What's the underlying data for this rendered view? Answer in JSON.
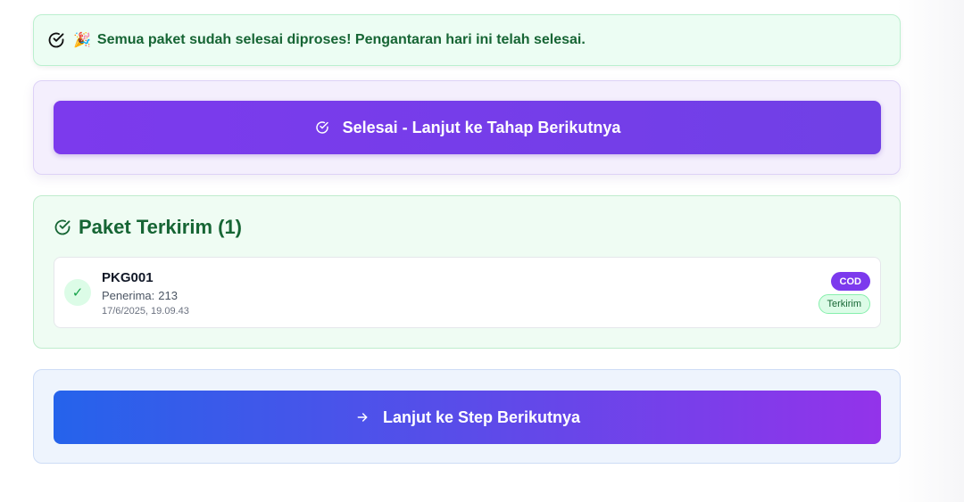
{
  "alert": {
    "icon": "check-circle-icon",
    "emoji": "🎉",
    "message": "Semua paket sudah selesai diproses! Pengantaran hari ini telah selesai."
  },
  "finish_button": {
    "icon": "check-circle-icon",
    "label": "Selesai - Lanjut ke Tahap Berikutnya"
  },
  "delivered": {
    "title": "Paket Terkirim (1)",
    "packages": [
      {
        "id": "PKG001",
        "recipient_label": "Penerima:",
        "recipient": "213",
        "timestamp": "17/6/2025, 19.09.43",
        "payment_badge": "COD",
        "status_badge": "Terkirim"
      }
    ]
  },
  "next_button": {
    "icon": "arrow-right-icon",
    "label": "Lanjut ke Step Berikutnya"
  },
  "colors": {
    "success": "#166534",
    "purple": "#7c3aed",
    "blue": "#2563eb"
  }
}
